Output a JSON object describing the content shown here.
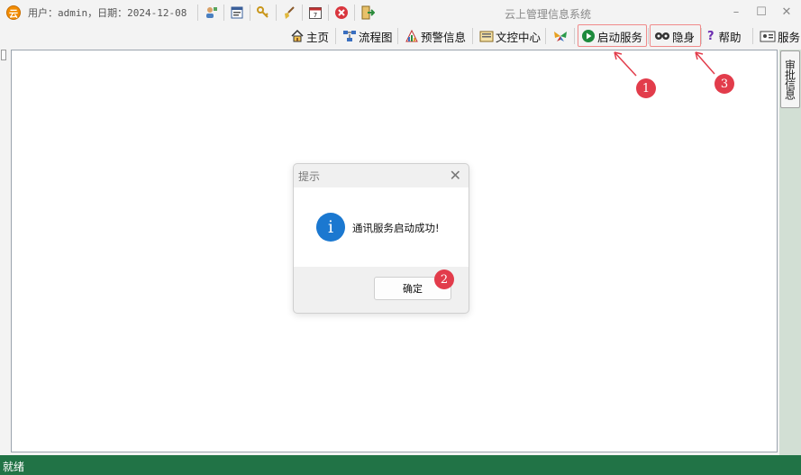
{
  "titlebar": {
    "logo_char": "云",
    "user_info": "用户：admin，日期：2024-12-08",
    "window_title": "云上管理信息系统",
    "minimize": "–",
    "maximize": "☐",
    "close": "✕"
  },
  "toolbar": {
    "home": "主页",
    "flowchart": "流程图",
    "alert_info": "预警信息",
    "doc_center": "文控中心",
    "start_service": "启动服务",
    "invisible": "隐身",
    "help": "帮助",
    "service": "服务"
  },
  "side_tab": {
    "label": "审批信息"
  },
  "dialog": {
    "title": "提示",
    "close": "✕",
    "icon_char": "i",
    "message": "通讯服务启动成功!",
    "ok_button": "确定"
  },
  "badges": {
    "one": "1",
    "two": "2",
    "three": "3"
  },
  "status_bar": {
    "text": "就绪"
  },
  "colors": {
    "accent_status": "#217346",
    "badge": "#e23c4b",
    "info_icon": "#1b78d0"
  }
}
